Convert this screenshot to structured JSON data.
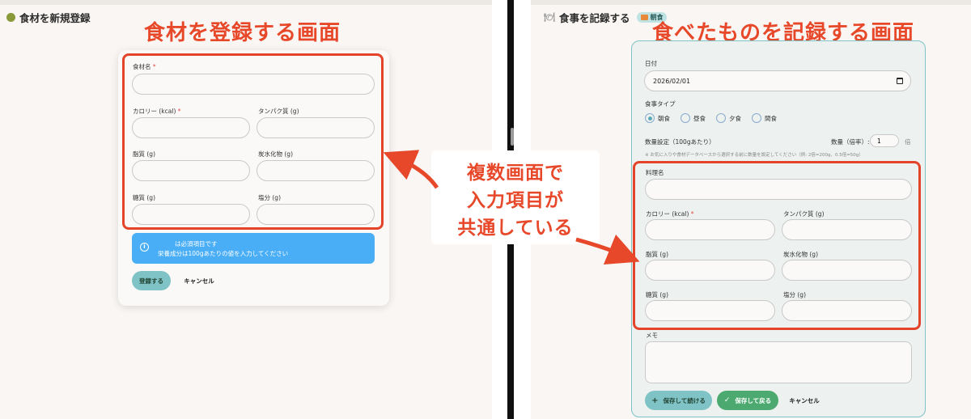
{
  "left": {
    "page_title": "食材を新規登録",
    "annotation": "食材を登録する画面",
    "labels": {
      "name": "食材名",
      "calorie": "カロリー (kcal)",
      "protein": "タンパク質 (g)",
      "fat": "脂質 (g)",
      "carbs": "炭水化物 (g)",
      "sugar": "糖質 (g)",
      "salt": "塩分 (g)"
    },
    "required_mark": "*",
    "info": {
      "line1": "は必須項目です",
      "line2": "栄養成分は100gあたりの値を入力してください"
    },
    "buttons": {
      "register": "登録する",
      "cancel": "キャンセル"
    }
  },
  "right": {
    "page_title": "食事を記録する",
    "tag": "朝食",
    "annotation": "食べたものを記録する画面",
    "labels": {
      "date": "日付",
      "meal_type": "食事タイプ",
      "quantity_setting": "数量設定（100gあたり）",
      "quantity": "数量（倍率）:",
      "dish_name": "料理名",
      "calorie": "カロリー (kcal)",
      "protein": "タンパク質 (g)",
      "fat": "脂質 (g)",
      "carbs": "炭水化物 (g)",
      "sugar": "糖質 (g)",
      "salt": "塩分 (g)",
      "memo": "メモ"
    },
    "required_mark": "*",
    "date_value": "2026/02/01",
    "meal_types": [
      "朝食",
      "昼食",
      "夕食",
      "間食"
    ],
    "selected_meal_type": "朝食",
    "quantity_value": "1",
    "quantity_suffix": "倍",
    "quantity_hint": "※ お気に入りや食材データベースから選択する前に数量を設定してください（例: 2倍=200g、0.5倍=50g）",
    "buttons": {
      "save_continue": "保存して続ける",
      "save_back": "保存して戻る",
      "cancel": "キャンセル"
    }
  },
  "callout": {
    "lines": [
      "複数画面で",
      "入力項目が",
      "共通している"
    ]
  },
  "colors": {
    "annotation_red": "#e8482a",
    "accent_teal": "#7fc3c6",
    "info_blue": "#4aaef7",
    "save_green": "#4caa70"
  }
}
